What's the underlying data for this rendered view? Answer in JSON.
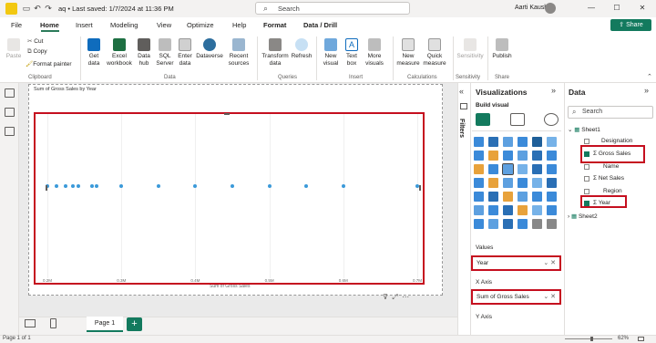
{
  "titlebar": {
    "doc_title": "aq • Last saved: 1/7/2024 at 11:36 PM",
    "search_label": "Search",
    "user_name": "Aarti Kaushik"
  },
  "menu": {
    "tabs": [
      "File",
      "Home",
      "Insert",
      "Modeling",
      "View",
      "Optimize",
      "Help",
      "Format",
      "Data / Drill"
    ],
    "share_label": "Share"
  },
  "ribbon": {
    "clipboard": {
      "paste": "Paste",
      "cut": "Cut",
      "copy": "Copy",
      "format_painter": "Format painter",
      "group": "Clipboard"
    },
    "data": {
      "get_data": "Get data",
      "excel": "Excel workbook",
      "data_hub": "Data hub",
      "sql": "SQL Server",
      "enter": "Enter data",
      "dataverse": "Dataverse",
      "recent": "Recent sources",
      "group": "Data"
    },
    "queries": {
      "transform": "Transform data",
      "refresh": "Refresh",
      "group": "Queries"
    },
    "insert": {
      "new_visual": "New visual",
      "text_box": "Text box",
      "more_visuals": "More visuals",
      "group": "Insert"
    },
    "calculations": {
      "new_measure": "New measure",
      "quick_measure": "Quick measure",
      "group": "Calculations"
    },
    "sensitivity": {
      "label": "Sensitivity",
      "group": "Sensitivity"
    },
    "share": {
      "publish": "Publish",
      "group": "Share"
    }
  },
  "canvas": {
    "visual_title": "Sum of Gross Sales by Year",
    "page_tab": "Page 1",
    "add_page": "+"
  },
  "chart_data": {
    "type": "scatter",
    "title": "Sum of Gross Sales by Year",
    "xlabel": "Sum of Gross Sales",
    "ylabel": "",
    "tick_labels": [
      "0.2M",
      "0.3M",
      "0.4M",
      "0.5M",
      "0.6M",
      "0.7M"
    ],
    "xlim": [
      0.2,
      0.7
    ],
    "x": [
      0.2,
      0.212,
      0.225,
      0.235,
      0.242,
      0.26,
      0.267,
      0.3,
      0.35,
      0.4,
      0.45,
      0.5,
      0.55,
      0.6,
      0.7
    ],
    "y": [
      1,
      1,
      1,
      1,
      1,
      1,
      1,
      1,
      1,
      1,
      1,
      1,
      1,
      1,
      1
    ]
  },
  "filters": {
    "label": "Filters"
  },
  "visualizations": {
    "title": "Visualizations",
    "build_visual": "Build visual",
    "wells": {
      "values_label": "Values",
      "values_field": "Year",
      "x_axis_label": "X Axis",
      "x_axis_field": "Sum of Gross Sales",
      "y_axis_label": "Y Axis"
    }
  },
  "data": {
    "title": "Data",
    "search_placeholder": "Search",
    "tables": [
      {
        "name": "Sheet1",
        "fields": [
          {
            "name": "Designation",
            "checked": false,
            "sigma": false
          },
          {
            "name": "Gross Sales",
            "checked": true,
            "sigma": true
          },
          {
            "name": "Name",
            "checked": false,
            "sigma": false
          },
          {
            "name": "Net Sales",
            "checked": false,
            "sigma": true
          },
          {
            "name": "Region",
            "checked": false,
            "sigma": false
          },
          {
            "name": "Year",
            "checked": true,
            "sigma": true
          }
        ]
      },
      {
        "name": "Sheet2"
      }
    ]
  },
  "status": {
    "page_info": "Page 1 of 1",
    "zoom": "62%"
  }
}
